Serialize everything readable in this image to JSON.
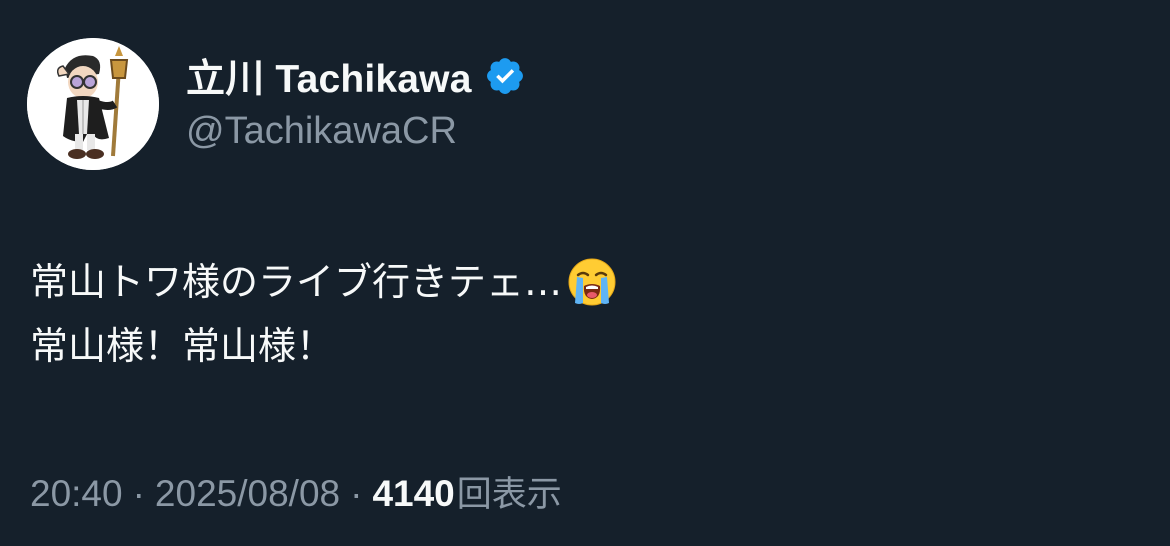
{
  "author": {
    "display_name": "立川 Tachikawa",
    "handle": "@TachikawaCR",
    "verified_icon": "verified-badge-icon",
    "avatar_icon": "cartoon-character-avatar"
  },
  "tweet": {
    "lines": [
      "常山トワ様のライブ行きテェ…",
      "常山様！常山様！"
    ],
    "emoji": "loudly-crying-face"
  },
  "meta": {
    "time": "20:40",
    "date": "2025/08/08",
    "separator": "·",
    "views_count": "4140",
    "views_label": "回表示"
  },
  "colors": {
    "background": "#15202b",
    "text_primary": "#f7f9f9",
    "text_secondary": "#8b98a5",
    "verified_blue": "#1d9bf0"
  }
}
